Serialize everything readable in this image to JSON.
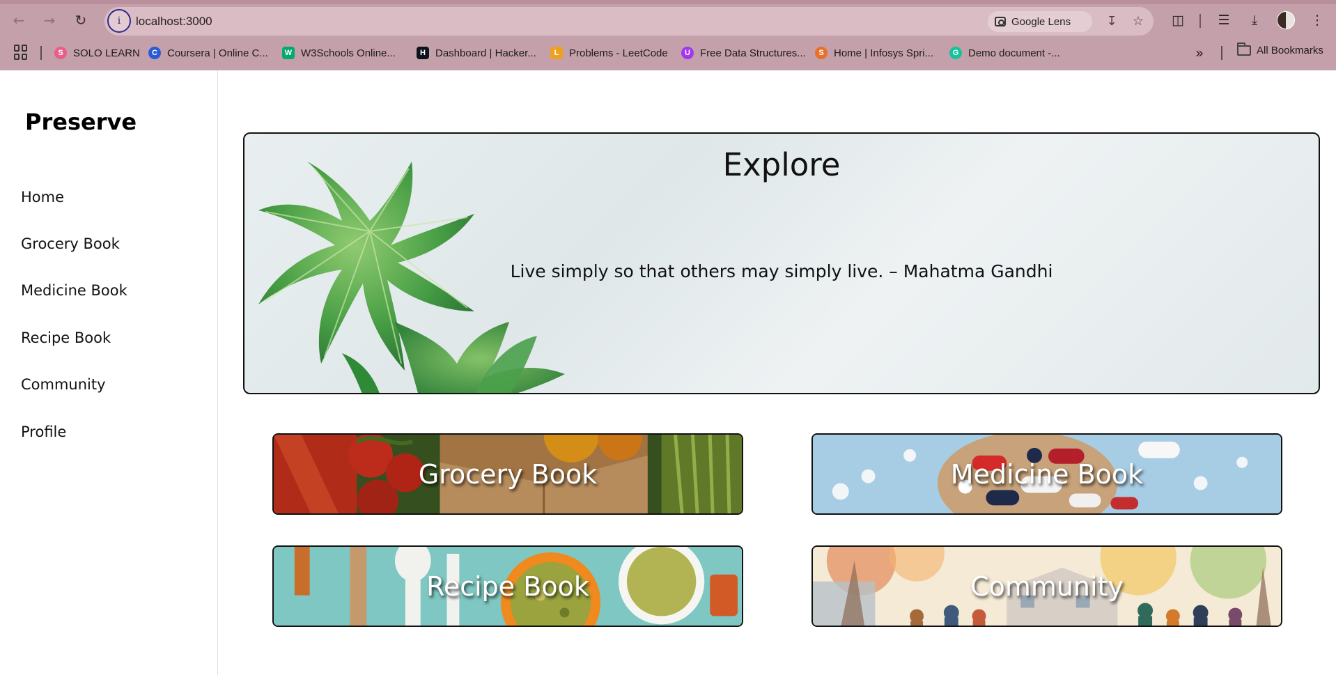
{
  "browser": {
    "url": "localhost:3000",
    "site_info_glyph": "i",
    "lens_label": "Google Lens",
    "bookmarks": [
      {
        "label": "SOLO LEARN",
        "icon": "sololearn-icon",
        "color": "#e85d8c"
      },
      {
        "label": "Coursera | Online C...",
        "icon": "coursera-icon",
        "color": "#2a5bd7"
      },
      {
        "label": "W3Schools Online...",
        "icon": "w3schools-icon",
        "color": "#04aa6d"
      },
      {
        "label": "Dashboard | Hacker...",
        "icon": "hackerrank-icon",
        "color": "#0e141e"
      },
      {
        "label": "Problems - LeetCode",
        "icon": "leetcode-icon",
        "color": "#f0a020"
      },
      {
        "label": "Free Data Structures...",
        "icon": "udemy-icon",
        "color": "#a435f0"
      },
      {
        "label": "Home | Infosys Spri...",
        "icon": "infosys-icon",
        "color": "#e8702a"
      },
      {
        "label": "Demo document -...",
        "icon": "grammarly-icon",
        "color": "#15c39a"
      }
    ],
    "all_bookmarks_label": "All Bookmarks"
  },
  "sidebar": {
    "brand": "Preserve",
    "items": [
      {
        "label": "Home"
      },
      {
        "label": "Grocery Book"
      },
      {
        "label": "Medicine Book"
      },
      {
        "label": "Recipe Book"
      },
      {
        "label": "Community"
      },
      {
        "label": "Profile"
      }
    ]
  },
  "hero": {
    "title": "Explore",
    "quote": "Live simply so that others may simply live. – Mahatma Gandhi"
  },
  "cards": [
    {
      "label": "Grocery Book"
    },
    {
      "label": "Medicine Book"
    },
    {
      "label": "Recipe Book"
    },
    {
      "label": "Community"
    }
  ],
  "colors": {
    "chrome": "#c4a0aa",
    "omnibox": "#d9bcc4",
    "border": "#111111"
  }
}
